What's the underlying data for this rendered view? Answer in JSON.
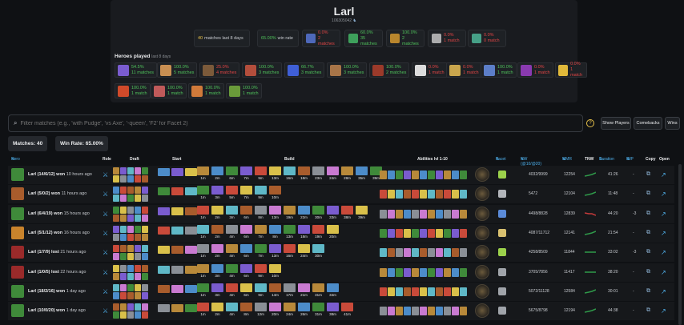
{
  "profile": {
    "name": "Larl",
    "id": "106305042"
  },
  "stats": [
    {
      "kind": "text",
      "count": "40",
      "text": "matches last 8 days"
    },
    {
      "kind": "text",
      "pct": "65.00%",
      "text": "win rate"
    },
    {
      "kind": "role",
      "icon": "carry-role-icon",
      "color": "#5a7be0",
      "pct": "0.0%",
      "pct_class": "red",
      "matches": "2 matches"
    },
    {
      "kind": "role",
      "icon": "mid-role-icon",
      "color": "#46c06a",
      "pct": "60.0%",
      "pct_class": "grn",
      "matches": "35 matches"
    },
    {
      "kind": "role",
      "icon": "offlane-role-icon",
      "color": "#e0a030",
      "pct": "100.0%",
      "pct_class": "grn",
      "matches": "2 matches"
    },
    {
      "kind": "role",
      "icon": "support-role-icon",
      "color": "#d0d0d0",
      "pct": "0.0%",
      "pct_class": "red",
      "matches": "1 match"
    },
    {
      "kind": "role",
      "icon": "hard-support-role-icon",
      "color": "#50c0a0",
      "pct": "0.0%",
      "pct_class": "red",
      "matches": "0 match"
    }
  ],
  "heroes_played": {
    "title": "Heroes played",
    "subtitle": "last 8 days"
  },
  "heroes": [
    {
      "pct": "54.5%",
      "cls": "grn",
      "m": "11 matches",
      "c": "#7a5ccf"
    },
    {
      "pct": "100.0%",
      "cls": "grn",
      "m": "5 matches",
      "c": "#c98f52"
    },
    {
      "pct": "25.0%",
      "cls": "red",
      "m": "4 matches",
      "c": "#7b5a3a"
    },
    {
      "pct": "100.0%",
      "cls": "grn",
      "m": "3 matches",
      "c": "#b34e3c"
    },
    {
      "pct": "66.7%",
      "cls": "grn",
      "m": "3 matches",
      "c": "#3f5fd6"
    },
    {
      "pct": "100.0%",
      "cls": "grn",
      "m": "3 matches",
      "c": "#a87548"
    },
    {
      "pct": "100.0%",
      "cls": "grn",
      "m": "2 matches",
      "c": "#9b3a2a"
    },
    {
      "pct": "0.0%",
      "cls": "red",
      "m": "1 match",
      "c": "#dcdcdc"
    },
    {
      "pct": "0.0%",
      "cls": "red",
      "m": "1 match",
      "c": "#c9a64d"
    },
    {
      "pct": "100.0%",
      "cls": "grn",
      "m": "1 match",
      "c": "#5c7ec8"
    },
    {
      "pct": "0.0%",
      "cls": "red",
      "m": "1 match",
      "c": "#8a3ab0"
    },
    {
      "pct": "0.0%",
      "cls": "red",
      "m": "1 match",
      "c": "#e0b93a"
    },
    {
      "pct": "100.0%",
      "cls": "grn",
      "m": "1 match",
      "c": "#d04a2a"
    },
    {
      "pct": "100.0%",
      "cls": "grn",
      "m": "1 match",
      "c": "#c05a5a"
    },
    {
      "pct": "100.0%",
      "cls": "grn",
      "m": "1 match",
      "c": "#d07a3a"
    },
    {
      "pct": "100.0%",
      "cls": "grn",
      "m": "1 match",
      "c": "#6a9a3a"
    }
  ],
  "search": {
    "placeholder": "Filter matches (e.g., 'with Pudge', 'vs Axe', '-queen', 'F2' for Facet 2)",
    "help": "?"
  },
  "buttons": {
    "show_players": "Show Players",
    "comebacks": "Comebacks",
    "wins": "Wins"
  },
  "summary": {
    "matches": "Matches: 40",
    "winrate": "Win Rate: 65.00%"
  },
  "columns": {
    "hero": "Hero",
    "hero_sort": "⇅",
    "role": "Role",
    "draft": "Draft",
    "start": "Start",
    "build": "Build",
    "abilities": "Abilities lvl 1-10",
    "facet": "Facet",
    "facet_sort": "⇅",
    "nw": "NW (@10/@20)",
    "nw_sort": "⇅",
    "mmr": "MMR",
    "mmr_sort": "⇅",
    "tnw": "TNW",
    "duration": "Duration",
    "duration_sort": "⇅",
    "imp": "IMP",
    "imp_sort": "⇅",
    "copy": "Copy",
    "open": "Open"
  },
  "matches": [
    {
      "kda": "Larl (14/6/12)",
      "res": "won",
      "ago": "10 hours ago",
      "hero_color": "#3f8a3a",
      "times": [
        "1m",
        "2m",
        "6m",
        "7m",
        "9m",
        "13m",
        "16m",
        "18m",
        "23m",
        "24m",
        "28m",
        "35m",
        "39m"
      ],
      "facet_color": "#9bd14b",
      "nw": "4032/9999",
      "mmr": "12254",
      "tnw": "up",
      "dur": "41:26",
      "imp": "-"
    },
    {
      "kda": "Larl (5/0/2)",
      "res": "won",
      "ago": "11 hours ago",
      "hero_color": "#a85c2c",
      "times": [
        "1m",
        "3m",
        "5m",
        "7m",
        "9m",
        "10m"
      ],
      "facet_color": "#b2b5ba",
      "nw": "5472",
      "mmr": "12104",
      "tnw": "up",
      "dur": "11:48",
      "imp": "-"
    },
    {
      "kda": "Larl (6/4/19)",
      "res": "won",
      "ago": "15 hours ago",
      "hero_color": "#3f8a3a",
      "times": [
        "1m",
        "2m",
        "3m",
        "6m",
        "8m",
        "13m",
        "19m",
        "22m",
        "30m",
        "33m",
        "38m",
        "39m"
      ],
      "facet_color": "#5a8ad8",
      "nw": "4498/8828",
      "mmr": "12839",
      "tnw": "down",
      "dur": "44:20",
      "imp": "-3"
    },
    {
      "kda": "Larl (5/1/12)",
      "res": "won",
      "ago": "16 hours ago",
      "hero_color": "#c9842c",
      "times": [
        "1m",
        "2m",
        "4m",
        "6m",
        "7m",
        "8m",
        "13m",
        "18m",
        "19m",
        "20m"
      ],
      "facet_color": "#d8c070",
      "nw": "4087/11712",
      "mmr": "12141",
      "tnw": "up",
      "dur": "21:54",
      "imp": "-"
    },
    {
      "kda": "Larl (1/7/9)",
      "res": "lost",
      "ago": "21 hours ago",
      "hero_color": "#9a2a2a",
      "times": [
        "1m",
        "2m",
        "4m",
        "6m",
        "7m",
        "13m",
        "16m",
        "24m",
        "30m"
      ],
      "facet_color": "#9bd14b",
      "nw": "4258/8509",
      "mmr": "11844",
      "tnw": "flat",
      "dur": "33:02",
      "imp": "-3"
    },
    {
      "kda": "Larl (1/0/5)",
      "res": "lost",
      "ago": "22 hours ago",
      "hero_color": "#9a2a2a",
      "times": [
        "1m",
        "3m",
        "4m",
        "6m",
        "9m",
        "10m"
      ],
      "facet_color": "#a0a4aa",
      "nw": "3705/7856",
      "mmr": "11417",
      "tnw": "flat",
      "dur": "38:20",
      "imp": "-"
    },
    {
      "kda": "Larl (18/2/16)",
      "res": "won",
      "ago": "1 day ago",
      "hero_color": "#3f8a3a",
      "times": [
        "1m",
        "3m",
        "4m",
        "6m",
        "9m",
        "14m",
        "17m",
        "21m",
        "31m",
        "34m"
      ],
      "facet_color": "#a0a4aa",
      "nw": "5072/11128",
      "mmr": "12584",
      "tnw": "up",
      "dur": "30:01",
      "imp": "-"
    },
    {
      "kda": "Larl (10/0/20)",
      "res": "won",
      "ago": "1 day ago",
      "hero_color": "#3f8a3a",
      "times": [
        "1m",
        "2m",
        "4m",
        "8m",
        "12m",
        "20m",
        "24m",
        "26m",
        "31m",
        "38m",
        "41m"
      ],
      "facet_color": "#a0a4aa",
      "nw": "5675/8798",
      "mmr": "12194",
      "tnw": "up",
      "dur": "44:38",
      "imp": "-"
    }
  ],
  "palette": [
    "#b8893a",
    "#4c8cc9",
    "#3f8a3a",
    "#7a5ccf",
    "#c94a3a",
    "#d9c04a",
    "#5fb8c7",
    "#a85c2c",
    "#8a8f96",
    "#c97ad1"
  ]
}
